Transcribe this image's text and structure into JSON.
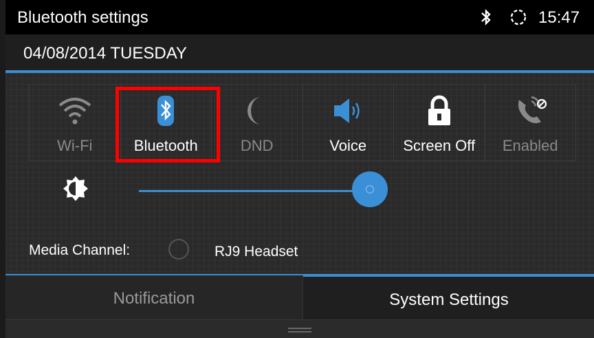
{
  "statusbar": {
    "title": "Bluetooth settings",
    "time": "15:47",
    "icons": [
      "bluetooth-icon",
      "sync-icon"
    ]
  },
  "date": "04/08/2014 TUESDAY",
  "quick_toggles": [
    {
      "label": "Wi-Fi",
      "icon": "wifi-icon",
      "active": false
    },
    {
      "label": "Bluetooth",
      "icon": "bluetooth-icon",
      "active": true
    },
    {
      "label": "DND",
      "icon": "moon-icon",
      "active": false
    },
    {
      "label": "Voice",
      "icon": "speaker-icon",
      "active": true
    },
    {
      "label": "Screen Off",
      "icon": "lock-icon",
      "active": true
    },
    {
      "label": "Enabled",
      "icon": "phone-disabled-icon",
      "active": false
    }
  ],
  "brightness": {
    "icon": "brightness-icon",
    "level": 0.95
  },
  "media": {
    "label": "Media Channel:",
    "value": "RJ9 Headset"
  },
  "tabs": {
    "left": "Notification",
    "right": "System Settings"
  },
  "colors": {
    "accent": "#3b8fd6",
    "highlight": "#ff0000"
  }
}
